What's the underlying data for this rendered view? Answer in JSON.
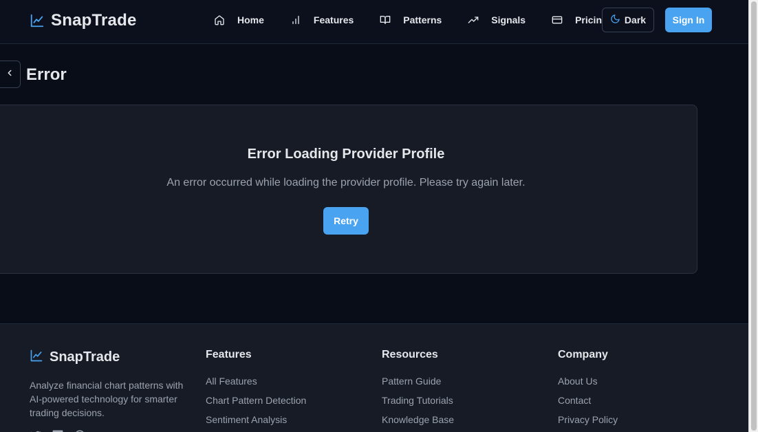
{
  "brand": {
    "name": "SnapTrade",
    "logo_icon": "chart-line-icon",
    "accent": "#4aa3f0"
  },
  "nav": {
    "items": [
      {
        "label": "Home",
        "icon": "home-icon"
      },
      {
        "label": "Features",
        "icon": "bar-chart-icon"
      },
      {
        "label": "Patterns",
        "icon": "book-open-icon"
      },
      {
        "label": "Signals",
        "icon": "trending-up-icon"
      },
      {
        "label": "Pricing",
        "icon": "credit-card-icon"
      }
    ],
    "theme_label": "Dark",
    "theme_icon": "moon-icon",
    "signin_label": "Sign In"
  },
  "page": {
    "title": "Error",
    "back_icon": "chevron-left-icon"
  },
  "error": {
    "title": "Error Loading Provider Profile",
    "message": "An error occurred while loading the provider profile. Please try again later.",
    "retry_label": "Retry"
  },
  "footer": {
    "brand_name": "SnapTrade",
    "description": "Analyze financial chart patterns with AI-powered technology for smarter trading decisions.",
    "social_icons": [
      "twitter-icon",
      "linkedin-icon",
      "github-icon"
    ],
    "columns": [
      {
        "title": "Features",
        "links": [
          "All Features",
          "Chart Pattern Detection",
          "Sentiment Analysis"
        ]
      },
      {
        "title": "Resources",
        "links": [
          "Pattern Guide",
          "Trading Tutorials",
          "Knowledge Base"
        ]
      },
      {
        "title": "Company",
        "links": [
          "About Us",
          "Contact",
          "Privacy Policy"
        ]
      }
    ]
  }
}
